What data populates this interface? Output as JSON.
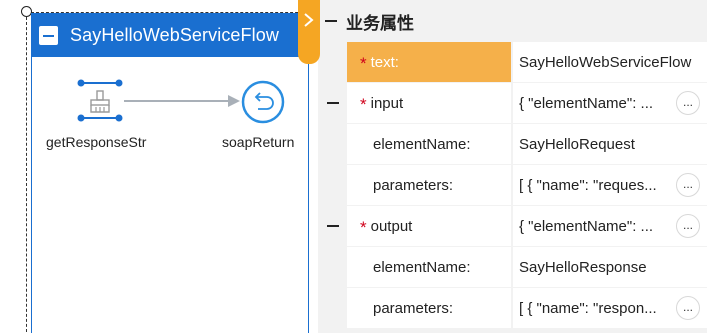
{
  "flow": {
    "title": "SayHelloWebServiceFlow",
    "nodes": [
      {
        "label": "getResponseStr"
      },
      {
        "label": "soapReturn"
      }
    ]
  },
  "panel": {
    "title": "业务属性",
    "rows": [
      {
        "key": "text:",
        "value": "SayHelloWebServiceFlow",
        "required": "*"
      },
      {
        "key": "input",
        "value": "{ \"elementName\": ...",
        "required": "*",
        "more": "..."
      },
      {
        "key": "elementName:",
        "value": "SayHelloRequest"
      },
      {
        "key": "parameters:",
        "value": "[ { \"name\": \"reques...",
        "more": "..."
      },
      {
        "key": "output",
        "value": "{ \"elementName\": ...",
        "required": "*",
        "more": "..."
      },
      {
        "key": "elementName:",
        "value": "SayHelloResponse"
      },
      {
        "key": "parameters:",
        "value": "[ { \"name\": \"respon...",
        "more": "..."
      }
    ]
  },
  "colors": {
    "accent": "#1a6fd0",
    "highlight": "#f5b04a",
    "tab": "#f5a623",
    "required": "#d0021b"
  },
  "icons": [
    "collapse-icon",
    "broom-task-icon",
    "return-icon",
    "chevron-right-icon",
    "collapse-minus-icon",
    "more-icon"
  ]
}
